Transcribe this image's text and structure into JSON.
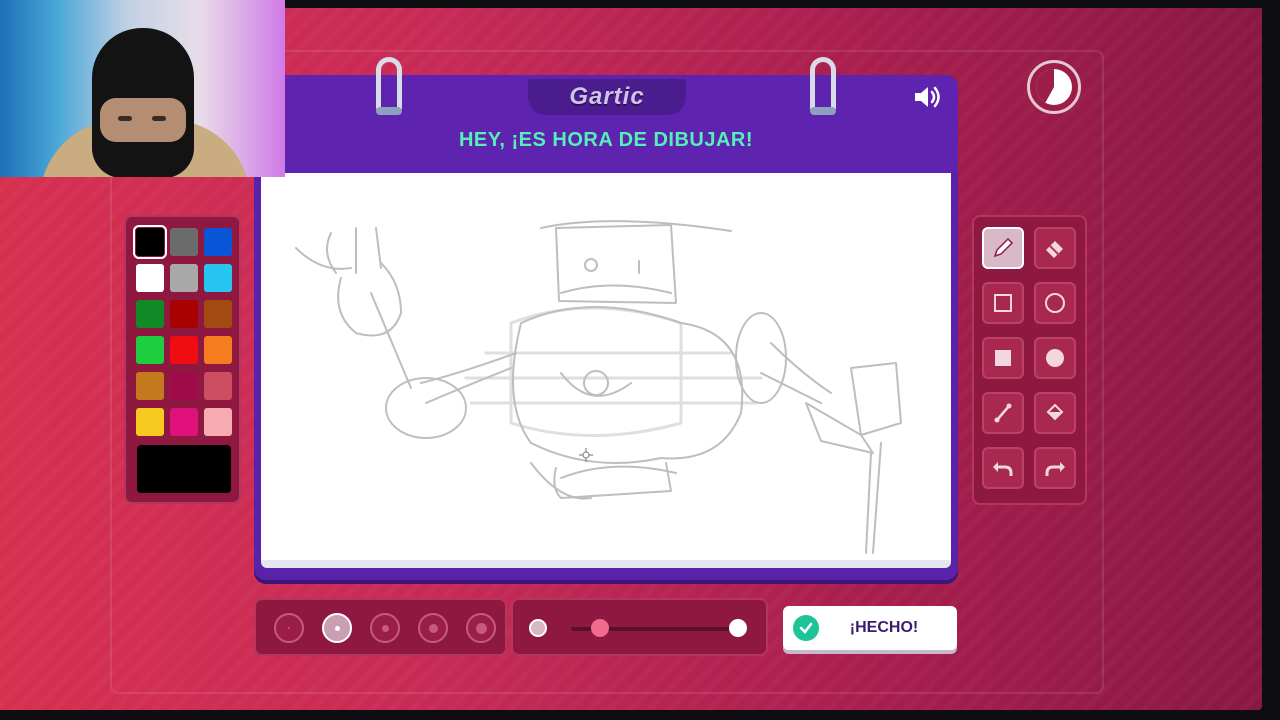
{
  "game": {
    "logo_text": "Gartic",
    "prompt": "HEY, ¡ES HORA DE DIBUJAR!"
  },
  "palette": {
    "colors": [
      "#000000",
      "#6b6b6b",
      "#0a56d8",
      "#ffffff",
      "#a9a9a9",
      "#27c6f0",
      "#108a26",
      "#a90000",
      "#a24a12",
      "#1fce3f",
      "#ef0c12",
      "#f57d20",
      "#c57a1e",
      "#a00a49",
      "#cc4d60",
      "#f7ca22",
      "#e0117b",
      "#f5abb0"
    ],
    "selected_index": 0,
    "current_color": "#000000"
  },
  "tools": {
    "items": [
      "pencil-icon",
      "eraser-icon",
      "rectangle-outline-icon",
      "circle-outline-icon",
      "rectangle-filled-icon",
      "circle-filled-icon",
      "line-icon",
      "fill-bucket-icon",
      "undo-icon",
      "redo-icon"
    ],
    "active": "pencil-icon"
  },
  "brush": {
    "sizes_count": 5,
    "selected_size_index": 1
  },
  "opacity": {
    "value": 0.2
  },
  "timer": {
    "remaining_fraction": 0.42
  },
  "done_button": {
    "label": "¡HECHO!"
  }
}
